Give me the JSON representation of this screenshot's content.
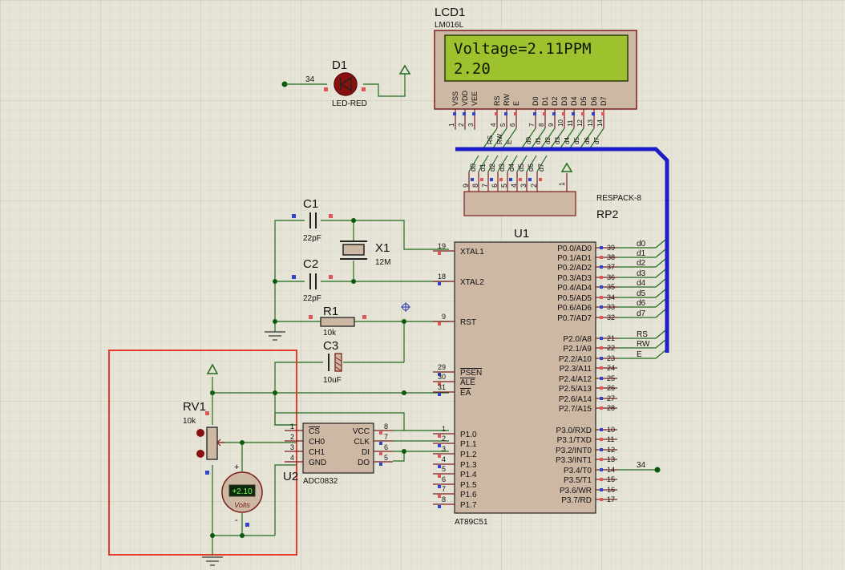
{
  "lcd": {
    "ref": "LCD1",
    "model": "LM016L",
    "line1": "Voltage=2.11PPM",
    "line2": "2.20",
    "pins": [
      "VSS",
      "VDD",
      "VEE",
      "RS",
      "RW",
      "E",
      "D0",
      "D1",
      "D2",
      "D3",
      "D4",
      "D5",
      "D6",
      "D7"
    ],
    "pin_nums": [
      "1",
      "2",
      "3",
      "4",
      "5",
      "6",
      "7",
      "8",
      "9",
      "10",
      "11",
      "12",
      "13",
      "14"
    ],
    "nets": [
      "RS",
      "RW",
      "E",
      "d0",
      "d1",
      "d2",
      "d3",
      "d4",
      "d5",
      "d6",
      "d7"
    ]
  },
  "led": {
    "ref": "D1",
    "type": "LED-RED",
    "net": "34"
  },
  "rp2": {
    "ref": "RP2",
    "type": "RESPACK-8",
    "pin1": "1",
    "pin_nums": [
      "9",
      "8",
      "7",
      "6",
      "5",
      "4",
      "3",
      "2"
    ],
    "nets": [
      "d0",
      "d1",
      "d2",
      "d3",
      "d4",
      "d5",
      "d6",
      "d7"
    ]
  },
  "c1": {
    "ref": "C1",
    "value": "22pF"
  },
  "c2": {
    "ref": "C2",
    "value": "22pF"
  },
  "x1": {
    "ref": "X1",
    "value": "12M"
  },
  "r1": {
    "ref": "R1",
    "value": "10k"
  },
  "c3": {
    "ref": "C3",
    "value": "10uF"
  },
  "rv1": {
    "ref": "RV1",
    "value": "10k"
  },
  "voltmeter": {
    "reading": "+2.10",
    "unit": "Volts",
    "plus": "+",
    "minus": "-"
  },
  "adc": {
    "ref": "U2",
    "type": "ADC0832",
    "left_pins": [
      {
        "num": "1",
        "name": "CS"
      },
      {
        "num": "2",
        "name": "CH0"
      },
      {
        "num": "3",
        "name": "CH1"
      },
      {
        "num": "4",
        "name": "GND"
      }
    ],
    "right_pins": [
      {
        "num": "8",
        "name": "VCC"
      },
      {
        "num": "7",
        "name": "CLK"
      },
      {
        "num": "6",
        "name": "DI"
      },
      {
        "num": "5",
        "name": "DO"
      }
    ]
  },
  "mcu": {
    "ref": "U1",
    "type": "AT89C51",
    "left_pins": [
      {
        "num": "19",
        "name": "XTAL1"
      },
      {
        "num": "18",
        "name": "XTAL2"
      },
      {
        "num": "9",
        "name": "RST"
      },
      {
        "num": "29",
        "name": "PSEN"
      },
      {
        "num": "30",
        "name": "ALE"
      },
      {
        "num": "31",
        "name": "EA"
      },
      {
        "num": "1",
        "name": "P1.0"
      },
      {
        "num": "2",
        "name": "P1.1"
      },
      {
        "num": "3",
        "name": "P1.2"
      },
      {
        "num": "4",
        "name": "P1.3"
      },
      {
        "num": "5",
        "name": "P1.4"
      },
      {
        "num": "6",
        "name": "P1.5"
      },
      {
        "num": "7",
        "name": "P1.6"
      },
      {
        "num": "8",
        "name": "P1.7"
      }
    ],
    "right_pins": [
      {
        "num": "39",
        "name": "P0.0/AD0"
      },
      {
        "num": "38",
        "name": "P0.1/AD1"
      },
      {
        "num": "37",
        "name": "P0.2/AD2"
      },
      {
        "num": "36",
        "name": "P0.3/AD3"
      },
      {
        "num": "35",
        "name": "P0.4/AD4"
      },
      {
        "num": "34",
        "name": "P0.5/AD5"
      },
      {
        "num": "33",
        "name": "P0.6/AD6"
      },
      {
        "num": "32",
        "name": "P0.7/AD7"
      },
      {
        "num": "21",
        "name": "P2.0/A8"
      },
      {
        "num": "22",
        "name": "P2.1/A9"
      },
      {
        "num": "23",
        "name": "P2.2/A10"
      },
      {
        "num": "24",
        "name": "P2.3/A11"
      },
      {
        "num": "25",
        "name": "P2.4/A12"
      },
      {
        "num": "26",
        "name": "P2.5/A13"
      },
      {
        "num": "27",
        "name": "P2.6/A14"
      },
      {
        "num": "28",
        "name": "P2.7/A15"
      },
      {
        "num": "10",
        "name": "P3.0/RXD"
      },
      {
        "num": "11",
        "name": "P3.1/TXD"
      },
      {
        "num": "12",
        "name": "P3.2/INT0"
      },
      {
        "num": "13",
        "name": "P3.3/INT1"
      },
      {
        "num": "14",
        "name": "P3.4/T0"
      },
      {
        "num": "15",
        "name": "P3.5/T1"
      },
      {
        "num": "16",
        "name": "P3.6/WR"
      },
      {
        "num": "17",
        "name": "P3.7/RD"
      }
    ],
    "p0_nets": [
      "d0",
      "d1",
      "d2",
      "d3",
      "d4",
      "d5",
      "d6",
      "d7"
    ],
    "p2_nets": [
      "RS",
      "RW",
      "E"
    ],
    "p34_net": "34"
  }
}
